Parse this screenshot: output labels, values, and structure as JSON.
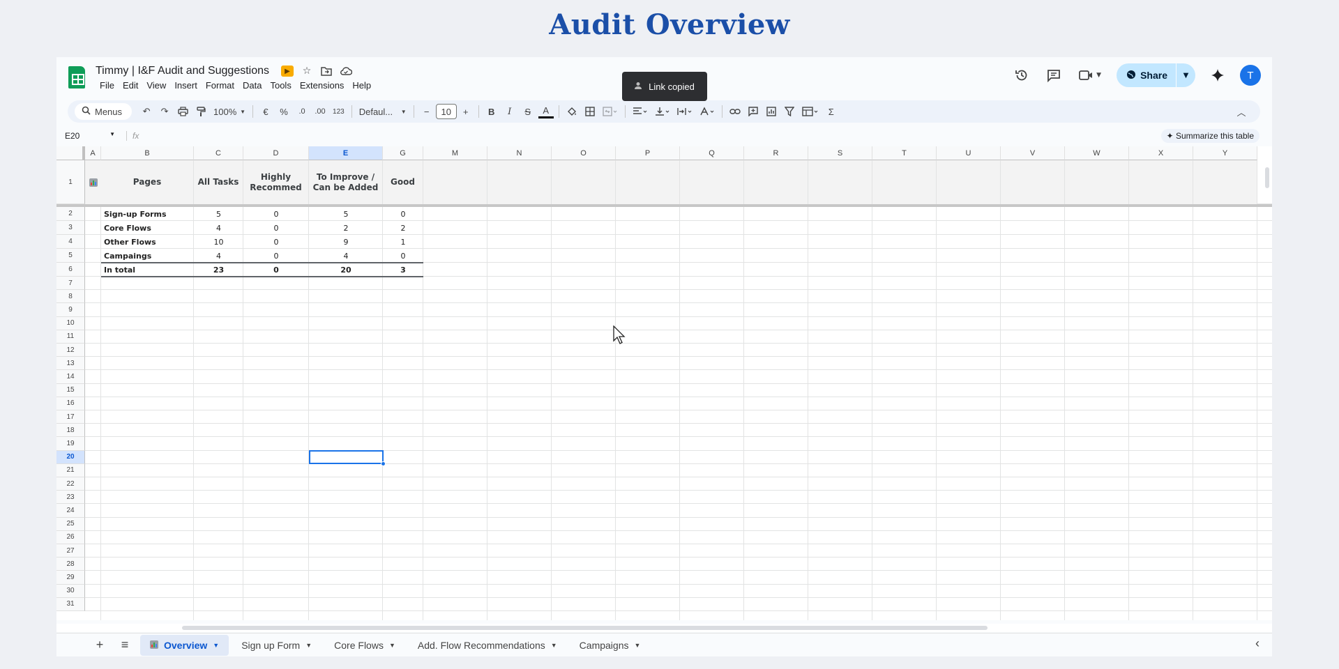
{
  "page_title": "Audit Overview",
  "doc": {
    "title": "Timmy | I&F Audit and Suggestions",
    "menu": [
      "File",
      "Edit",
      "View",
      "Insert",
      "Format",
      "Data",
      "Tools",
      "Extensions",
      "Help"
    ],
    "share_label": "Share",
    "avatar_initial": "T",
    "toast": "Link copied"
  },
  "toolbar": {
    "menus_label": "Menus",
    "zoom": "100%",
    "currency": "€",
    "percent": "%",
    "dec_decrease": ".0",
    "dec_increase": ".00",
    "number_format": "123",
    "font": "Defaul...",
    "font_size": "10",
    "bold": "B",
    "italic": "I",
    "strike": "S",
    "text_color": "A",
    "sum": "Σ"
  },
  "formula_bar": {
    "name_box": "E20",
    "fx": "fx",
    "summarize": "Summarize this table"
  },
  "columns": [
    "A",
    "B",
    "C",
    "D",
    "E",
    "G",
    "M",
    "N",
    "O",
    "P",
    "Q",
    "R",
    "S",
    "T",
    "U",
    "V",
    "W",
    "X",
    "Y"
  ],
  "selected_column": "E",
  "selected_row": 20,
  "table": {
    "headers": [
      "Pages",
      "All Tasks",
      "Highly Recommed",
      "To Improve / Can be Added",
      "Good"
    ],
    "rows": [
      [
        "Sign-up Forms",
        "5",
        "0",
        "5",
        "0"
      ],
      [
        "Core Flows",
        "4",
        "0",
        "2",
        "2"
      ],
      [
        "Other Flows",
        "10",
        "0",
        "9",
        "1"
      ],
      [
        "Campaings",
        "4",
        "0",
        "4",
        "0"
      ],
      [
        "In total",
        "23",
        "0",
        "20",
        "3"
      ]
    ]
  },
  "sheets": [
    {
      "name": "Overview",
      "active": true
    },
    {
      "name": "Sign up Form",
      "active": false
    },
    {
      "name": "Core Flows",
      "active": false
    },
    {
      "name": "Add. Flow Recommendations",
      "active": false
    },
    {
      "name": "Campaigns",
      "active": false
    }
  ],
  "colors": {
    "accent": "#1a73e8",
    "sheets_green": "#0f9d58",
    "heading_blue": "#1b4fa8",
    "share_bg": "#c2e7ff"
  }
}
